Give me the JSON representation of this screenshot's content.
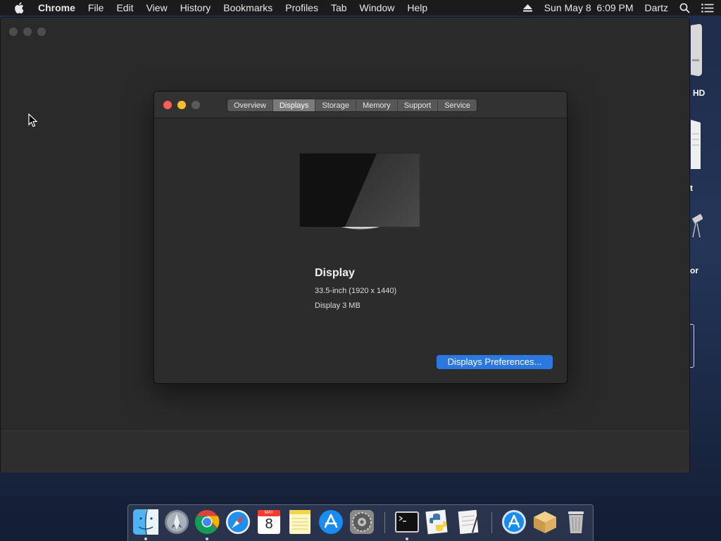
{
  "menubar": {
    "app_name": "Chrome",
    "items": [
      "File",
      "Edit",
      "View",
      "History",
      "Bookmarks",
      "Profiles",
      "Tab",
      "Window",
      "Help"
    ],
    "datetime": "Sun May 8  6:09 PM",
    "user": "Dartz"
  },
  "desktop": {
    "partial_labels": [
      "HD",
      "t",
      "or"
    ]
  },
  "dialog": {
    "tabs": [
      "Overview",
      "Displays",
      "Storage",
      "Memory",
      "Support",
      "Service"
    ],
    "active_tab": "Displays",
    "display_name": "Display",
    "display_size": "33.5-inch (1920 x 1440)",
    "display_memory": "Display 3 MB",
    "prefs_button": "Displays Preferences..."
  },
  "dock": {
    "apps": [
      "Finder",
      "Launchpad",
      "Chrome",
      "Safari",
      "Calendar",
      "Notes",
      "App Store",
      "System Preferences",
      "Terminal",
      "Python Launcher",
      "Script Editor",
      "Applications",
      "Installer",
      "Trash"
    ],
    "calendar_month": "MAY",
    "calendar_day": "8"
  },
  "colors": {
    "accent_blue": "#2a78e0",
    "close_red": "#fc5f57",
    "minimize_yellow": "#fdbc2e"
  }
}
